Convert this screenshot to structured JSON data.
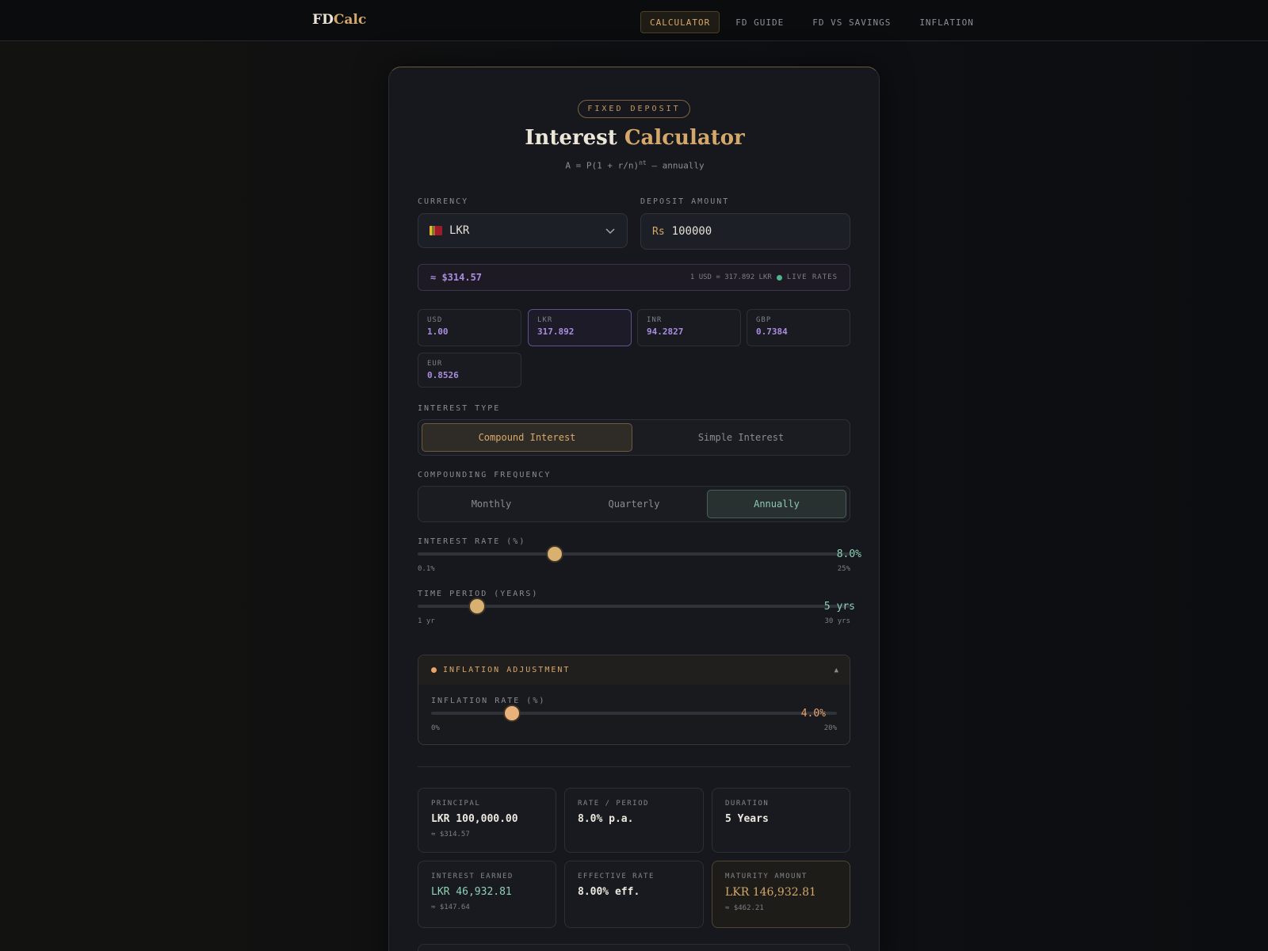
{
  "nav": {
    "logo_a": "FD",
    "logo_b": "Calc",
    "links": [
      "CALCULATOR",
      "FD GUIDE",
      "FD VS SAVINGS",
      "INFLATION"
    ],
    "active": "CALCULATOR"
  },
  "header": {
    "badge": "FIXED DEPOSIT",
    "title_a": "Interest ",
    "title_b": "Calculator",
    "formula_a": "A = P(1 + r/n)",
    "formula_sup": "nt",
    "formula_b": " — annually"
  },
  "currency": {
    "label": "CURRENCY",
    "value": "LKR",
    "flag": "sri-lanka-flag-icon"
  },
  "deposit": {
    "label": "DEPOSIT AMOUNT",
    "symbol": "Rs",
    "value": "100000"
  },
  "conversion": {
    "approx": "≈ $314.57",
    "rate": "1 USD = 317.892 LKR",
    "live": "LIVE RATES"
  },
  "rates": [
    {
      "code": "USD",
      "value": "1.00"
    },
    {
      "code": "LKR",
      "value": "317.892",
      "active": true
    },
    {
      "code": "INR",
      "value": "94.2827"
    },
    {
      "code": "GBP",
      "value": "0.7384"
    },
    {
      "code": "EUR",
      "value": "0.8526"
    }
  ],
  "interest_type": {
    "label": "INTEREST TYPE",
    "options": [
      "Compound Interest",
      "Simple Interest"
    ],
    "selected": "Compound Interest"
  },
  "frequency": {
    "label": "COMPOUNDING FREQUENCY",
    "options": [
      "Monthly",
      "Quarterly",
      "Annually"
    ],
    "selected": "Annually"
  },
  "rate_slider": {
    "label": "INTEREST RATE (%)",
    "value_text": "8.0%",
    "value": 8.0,
    "min_text": "0.1%",
    "max_text": "25%",
    "min": 0.1,
    "max": 25
  },
  "time_slider": {
    "label": "TIME PERIOD (YEARS)",
    "value_text": "5 yrs",
    "value": 5,
    "min_text": "1 yr",
    "max_text": "30 yrs",
    "min": 1,
    "max": 30
  },
  "inflation": {
    "title": "INFLATION ADJUSTMENT",
    "caret": "▲",
    "label": "INFLATION RATE (%)",
    "value_text": "4.0%",
    "value": 4.0,
    "min_text": "0%",
    "max_text": "20%",
    "min": 0,
    "max": 20
  },
  "results": {
    "principal": {
      "label": "PRINCIPAL",
      "value": "LKR 100,000.00",
      "sub": "≈ $314.57"
    },
    "rate": {
      "label": "RATE / PERIOD",
      "value": "8.0% p.a."
    },
    "duration": {
      "label": "DURATION",
      "value": "5 Years"
    },
    "interest": {
      "label": "INTEREST EARNED",
      "value": "LKR 46,932.81",
      "sub": "≈ $147.64"
    },
    "effective": {
      "label": "EFFECTIVE RATE",
      "value": "8.00% eff."
    },
    "maturity": {
      "label": "MATURITY AMOUNT",
      "value": "LKR 146,932.81",
      "sub": "≈ $462.21"
    }
  },
  "colors": {
    "accent_gold": "#d4a76a",
    "accent_purple": "#a98de0",
    "accent_teal": "#8fd0b6",
    "background": "#0d0e10"
  }
}
